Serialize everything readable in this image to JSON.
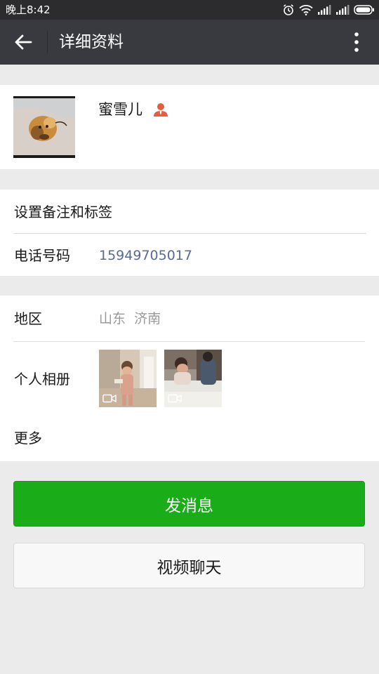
{
  "status_bar": {
    "time": "晚上8:42",
    "icons": [
      "alarm-icon",
      "wifi-icon",
      "signal-icon",
      "signal-icon",
      "battery-icon"
    ]
  },
  "app_bar": {
    "title": "详细资料",
    "back_icon": "back-arrow-icon",
    "more_icon": "more-vertical-icon"
  },
  "profile": {
    "nickname": "蜜雪儿",
    "badge_icon": "contact-person-icon",
    "badge_color": "#e0603f"
  },
  "rows": {
    "remark_label": "设置备注和标签",
    "phone_label": "电话号码",
    "phone_value": "15949705017",
    "region_label": "地区",
    "region_value": "山东  济南",
    "album_label": "个人相册",
    "more_label": "更多"
  },
  "album": {
    "items": [
      {
        "type": "video",
        "icon": "video-camera-icon"
      },
      {
        "type": "video",
        "icon": "video-camera-icon"
      }
    ]
  },
  "buttons": {
    "send_message": "发消息",
    "video_chat": "视频聊天"
  },
  "colors": {
    "primary_green": "#1aad19",
    "app_bar": "#393a3f",
    "link_blue": "#576b95",
    "secondary_text": "#999999"
  }
}
